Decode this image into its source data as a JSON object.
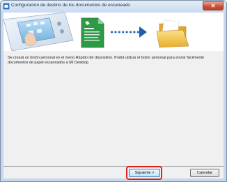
{
  "window": {
    "title": "Configuración de destino de los documentos de escaneado",
    "close_label": "✕"
  },
  "banner": {
    "device_icon": "scanner-panel-icon",
    "document_icon": "document-icon",
    "arrow_icon": "dotted-arrow-icon",
    "folder_icon": "folder-icon"
  },
  "content": {
    "description": "Se creará un botón personal en el menú Rápido del dispositivo. Podrá utilizar el botón personal para enviar fácilmente documentos de papel escaneados a iW Desktop."
  },
  "footer": {
    "next_label": "Siguiente >",
    "cancel_label": "Cancelar"
  },
  "colors": {
    "highlight": "#e02020",
    "folder": "#f2c94a",
    "arrow": "#1c5fb0",
    "document": "#2e9a48"
  }
}
